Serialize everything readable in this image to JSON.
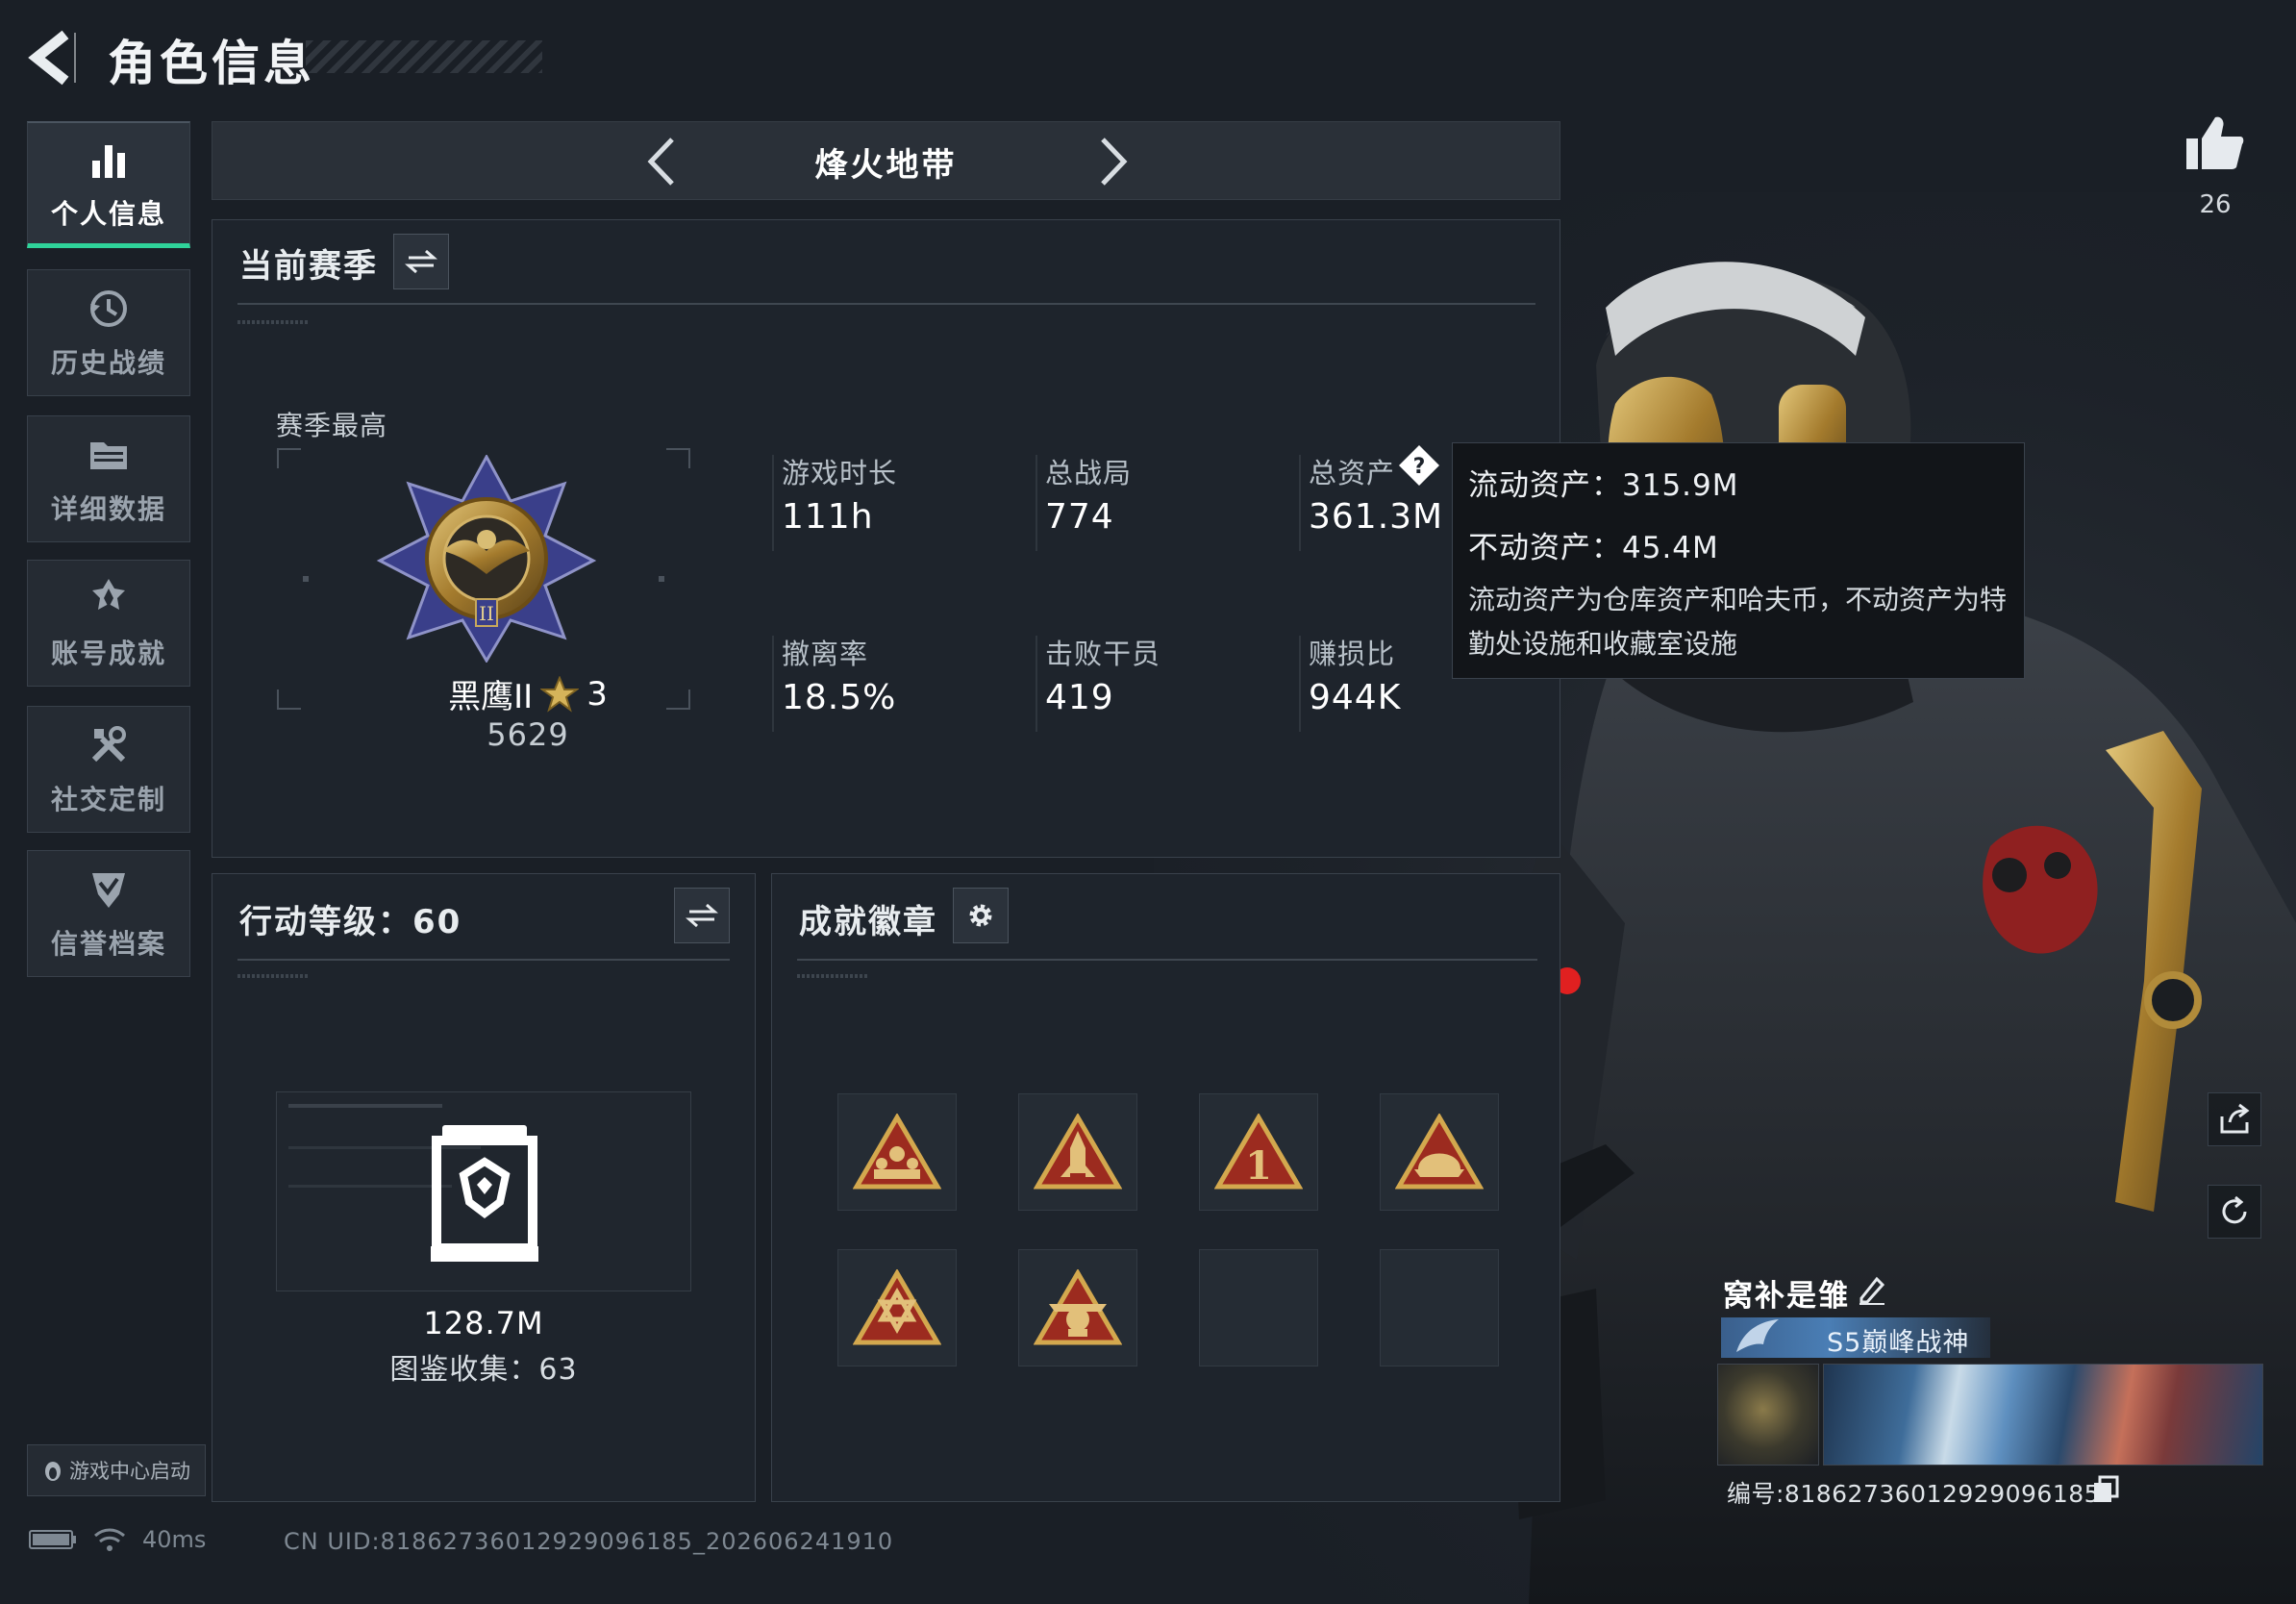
{
  "header": {
    "title": "角色信息"
  },
  "nav": {
    "items": [
      {
        "label": "个人信息",
        "icon": "bar-chart-icon",
        "active": true
      },
      {
        "label": "历史战绩",
        "icon": "history-clock-icon",
        "active": false
      },
      {
        "label": "详细数据",
        "icon": "folder-icon",
        "active": false
      },
      {
        "label": "账号成就",
        "icon": "achievement-star-icon",
        "active": false
      },
      {
        "label": "社交定制",
        "icon": "tools-icon",
        "active": false
      },
      {
        "label": "信誉档案",
        "icon": "shield-check-icon",
        "active": false
      }
    ],
    "launch_chip": "游戏中心启动"
  },
  "mode": {
    "name": "烽火地带"
  },
  "season": {
    "title": "当前赛季",
    "best_label": "赛季最高",
    "rank_name": "黑鹰II",
    "rank_stars": "3",
    "rank_score": "5629",
    "stats": [
      {
        "label": "游戏时长",
        "value": "111h"
      },
      {
        "label": "总战局",
        "value": "774"
      },
      {
        "label": "总资产",
        "value": "361.3M"
      },
      {
        "label": "撤离率",
        "value": "18.5%"
      },
      {
        "label": "击败干员",
        "value": "419"
      },
      {
        "label": "赚损比",
        "value": "944K"
      }
    ]
  },
  "tooltip": {
    "line1": "流动资产：315.9M",
    "line2": "不动资产：45.4M",
    "desc": "流动资产为仓库资产和哈夫币，不动资产为特勤处设施和收藏室设施"
  },
  "level": {
    "title": "行动等级：60",
    "value": "128.7M",
    "collection": "图鉴收集：63"
  },
  "achievements": {
    "title": "成就徽章",
    "badges": [
      "badge-team-icon",
      "badge-rocket-icon",
      "badge-number-one-icon",
      "badge-helmet-icon",
      "badge-hexagram-icon",
      "badge-eagle-icon",
      "",
      ""
    ]
  },
  "profile": {
    "likes": "26",
    "player_name": "窝补是雏",
    "title_text": "S5巅峰战神",
    "card_id": "编号:81862736012929096185"
  },
  "status": {
    "latency": "40ms",
    "uid": "CN UID:81862736012929096185_202606241910"
  },
  "colors": {
    "accent_green": "#2fd39a",
    "gold": "#c9a24a",
    "badge_red": "#9c2b1f"
  }
}
